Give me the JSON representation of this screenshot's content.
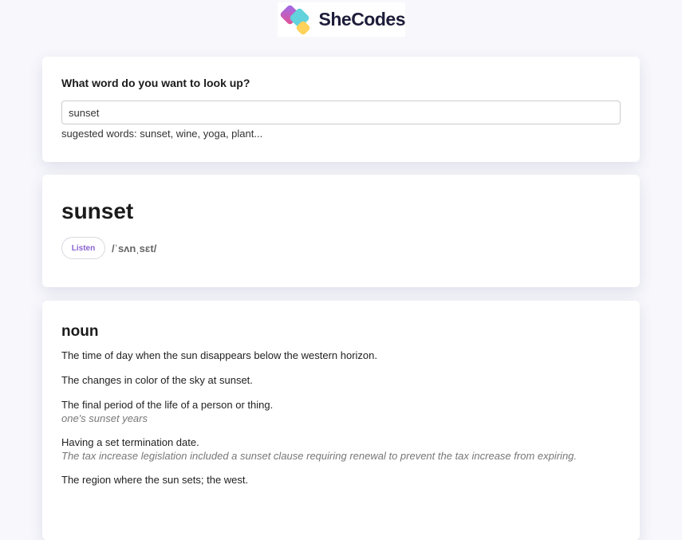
{
  "header": {
    "logo_text": "SheCodes"
  },
  "search": {
    "label": "What word do you want to look up?",
    "value": "sunset",
    "hint": "sugested words: sunset, wine, yoga, plant..."
  },
  "word": {
    "term": "sunset",
    "listen_label": "Listen",
    "phonetic": "/ˈsʌnˌsɛt/"
  },
  "meaning": {
    "part_of_speech": "noun",
    "definitions": [
      {
        "text": "The time of day when the sun disappears below the western horizon."
      },
      {
        "text": "The changes in color of the sky at sunset."
      },
      {
        "text": "The final period of the life of a person or thing.",
        "example": "one's sunset years"
      },
      {
        "text": "Having a set termination date.",
        "example": "The tax increase legislation included a sunset clause requiring renewal to prevent the tax increase from expiring."
      },
      {
        "text": "The region where the sun sets; the west."
      }
    ]
  }
}
